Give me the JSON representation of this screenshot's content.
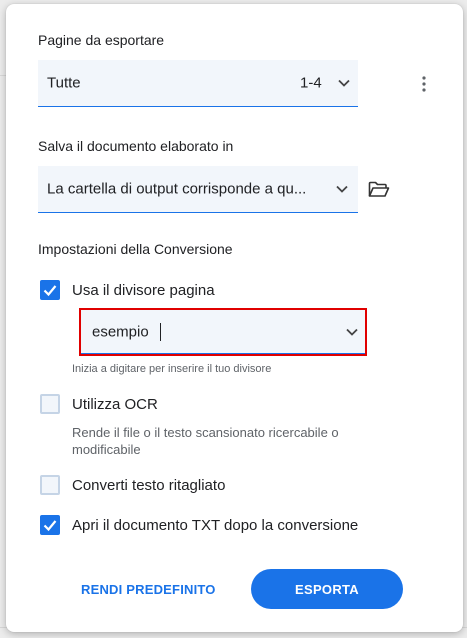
{
  "pages": {
    "section_label": "Pagine da esportare",
    "selected": "Tutte",
    "range": "1-4"
  },
  "save": {
    "section_label": "Salva il documento elaborato in",
    "selected": "La cartella di output corrisponde a qu..."
  },
  "conversion": {
    "section_label": "Impostazioni della Conversione",
    "divider": {
      "label": "Usa il divisore pagina",
      "checked": true,
      "value": "esempio",
      "hint": "Inizia a digitare per inserire il tuo divisore"
    },
    "ocr": {
      "label": "Utilizza OCR",
      "checked": false,
      "description": "Rende il file o il testo scansionato ricercabile o modificabile"
    },
    "cropped": {
      "label": "Converti testo ritagliato",
      "checked": false
    },
    "open_after": {
      "label": "Apri il documento TXT dopo la conversione",
      "checked": true
    }
  },
  "actions": {
    "default_label": "RENDI PREDEFINITO",
    "export_label": "ESPORTA"
  },
  "colors": {
    "accent": "#1a73e8",
    "highlight_border": "#e00000"
  }
}
